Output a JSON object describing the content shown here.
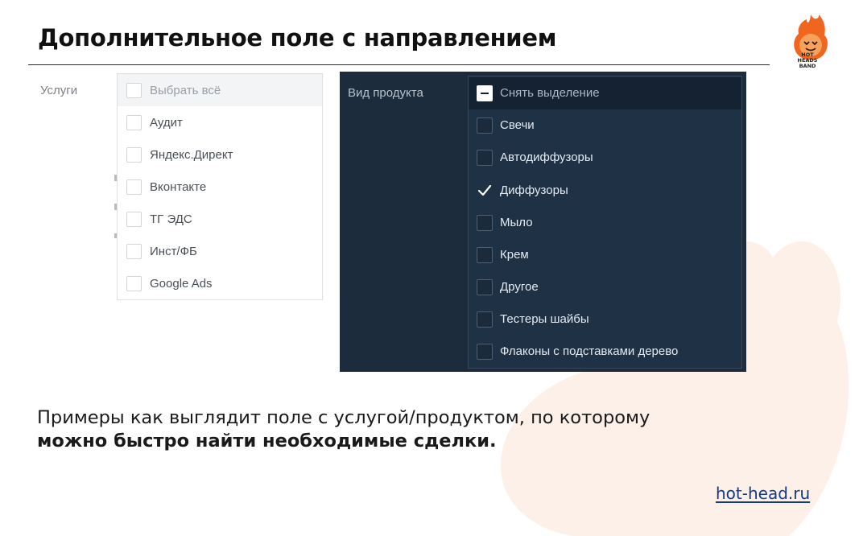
{
  "slide": {
    "title": "Дополнительное поле с направлением",
    "logo_lines": [
      "HOT",
      "HEADS",
      "BAND"
    ],
    "accent_color": "#f0661f"
  },
  "light_field": {
    "label": "Услуги",
    "items": [
      {
        "label": "Выбрать всё",
        "checked": false
      },
      {
        "label": "Аудит",
        "checked": false
      },
      {
        "label": "Яндекс.Директ",
        "checked": false
      },
      {
        "label": "Вконтакте",
        "checked": false
      },
      {
        "label": "ТГ ЭДС",
        "checked": false
      },
      {
        "label": "Инст/ФБ",
        "checked": false
      },
      {
        "label": "Google Ads",
        "checked": false
      }
    ]
  },
  "dark_field": {
    "label": "Вид продукта",
    "items": [
      {
        "label": "Снять выделение",
        "state": "indeterminate"
      },
      {
        "label": "Свечи",
        "state": "unchecked"
      },
      {
        "label": "Автодиффузоры",
        "state": "unchecked"
      },
      {
        "label": "Диффузоры",
        "state": "checked"
      },
      {
        "label": "Мыло",
        "state": "unchecked"
      },
      {
        "label": "Крем",
        "state": "unchecked"
      },
      {
        "label": "Другое",
        "state": "unchecked"
      },
      {
        "label": "Тестеры шайбы",
        "state": "unchecked"
      },
      {
        "label": "Флаконы с подставками дерево",
        "state": "unchecked"
      }
    ]
  },
  "caption": {
    "normal": "Примеры как выглядит поле с услугой/продуктом, по которому ",
    "bold": "можно быстро найти необходимые сделки."
  },
  "footer": {
    "link": "hot-head.ru"
  }
}
